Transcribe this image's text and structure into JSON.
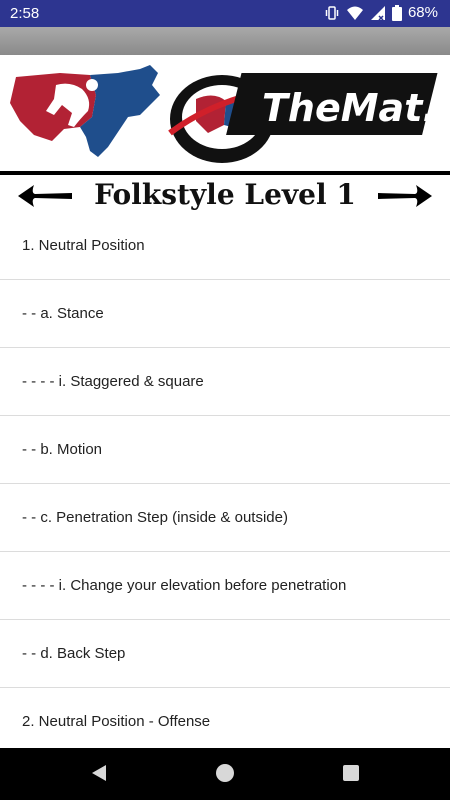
{
  "status_bar": {
    "time": "2:58",
    "battery": "68%",
    "icons": [
      "vibrate-icon",
      "wifi-icon",
      "signal-icon",
      "battery-icon"
    ]
  },
  "banner": {
    "logo_text": "TheMat.com",
    "colors": {
      "red": "#b22234",
      "blue": "#1f4e8c"
    }
  },
  "header": {
    "title": "Folkstyle Level 1",
    "prev_icon": "arrow-left-icon",
    "next_icon": "arrow-right-icon"
  },
  "list": {
    "items": [
      "1. Neutral Position",
      "- - a. Stance",
      "- - - - i. Staggered & square",
      "- - b. Motion",
      "- - c. Penetration Step (inside & outside)",
      "- - - - i. Change your elevation before penetration",
      "- - d. Back Step",
      "2. Neutral Position - Offense"
    ]
  },
  "nav_bar": {
    "buttons": [
      "back-icon",
      "home-icon",
      "recents-icon"
    ]
  }
}
